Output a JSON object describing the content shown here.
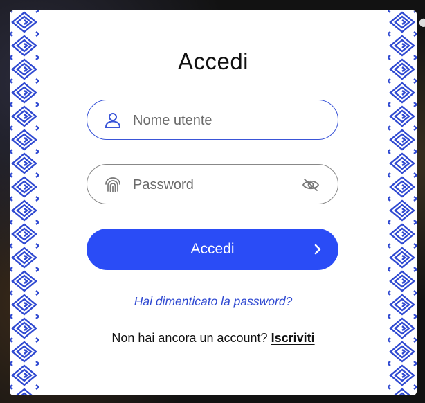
{
  "modal": {
    "title": "Accedi",
    "username": {
      "placeholder": "Nome utente",
      "value": ""
    },
    "password": {
      "placeholder": "Password",
      "value": ""
    },
    "login_button": {
      "label": "Accedi"
    },
    "forgot_link": "Hai dimenticato la password?",
    "signup": {
      "prompt": "Non hai ancora un account?",
      "link": "Iscriviti"
    }
  },
  "colors": {
    "accent": "#2a4cf6",
    "border_pattern": "#2f49d1",
    "link": "#2f49d1",
    "field_active_border": "#3a55d8",
    "field_border": "#888888"
  },
  "icons": {
    "username_field": "user-icon",
    "password_field": "fingerprint-icon",
    "password_toggle": "eye-off-icon",
    "login_button": "chevron-right-icon"
  }
}
